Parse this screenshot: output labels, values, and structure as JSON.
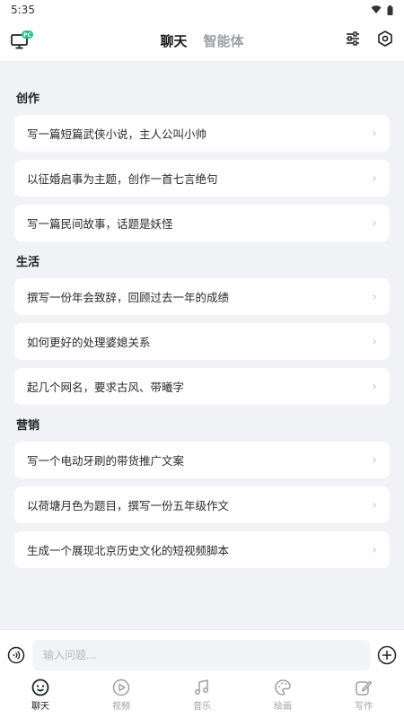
{
  "status": {
    "time": "5:35"
  },
  "header": {
    "badge": "PC",
    "tabs": [
      {
        "label": "聊天",
        "active": true
      },
      {
        "label": "智能体",
        "active": false
      }
    ],
    "icons": [
      "pc-icon",
      "filter-icon",
      "settings-icon"
    ]
  },
  "sections": [
    {
      "title": "创作",
      "items": [
        "写一篇短篇武侠小说，主人公叫小帅",
        "以征婚启事为主题，创作一首七言绝句",
        "写一篇民间故事，话题是妖怪"
      ]
    },
    {
      "title": "生活",
      "items": [
        "撰写一份年会致辞，回顾过去一年的成绩",
        "如何更好的处理婆媳关系",
        "起几个网名，要求古风、带曦字"
      ]
    },
    {
      "title": "营销",
      "items": [
        "写一个电动牙刷的带货推广文案",
        "以荷塘月色为题目，撰写一份五年级作文",
        "生成一个展现北京历史文化的短视频脚本"
      ]
    }
  ],
  "input": {
    "placeholder": "输入问题..."
  },
  "nav": [
    {
      "label": "聊天",
      "icon": "chat-icon",
      "active": true
    },
    {
      "label": "视频",
      "icon": "video-icon",
      "active": false
    },
    {
      "label": "音乐",
      "icon": "music-icon",
      "active": false
    },
    {
      "label": "绘画",
      "icon": "palette-icon",
      "active": false
    },
    {
      "label": "写作",
      "icon": "edit-icon",
      "active": false
    }
  ],
  "colors": {
    "accent": "#1ec28b",
    "background": "#f1f2f5"
  }
}
